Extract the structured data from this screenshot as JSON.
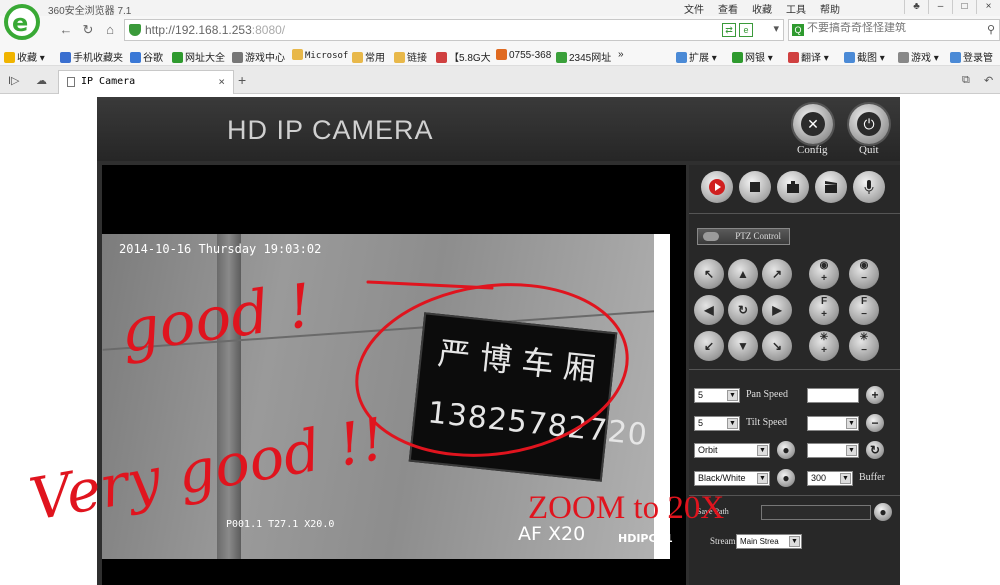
{
  "browser": {
    "app_name": "360安全浏览器 7.1",
    "menu": [
      "文件",
      "查看",
      "收藏",
      "工具",
      "帮助"
    ],
    "url_host": "http://192.168.1.253",
    "url_port": ":8080/",
    "search_placeholder": "不要搞奇奇怪怪建筑",
    "tab_title": "IP Camera",
    "new_tab": "+",
    "bookmarks": [
      {
        "label": "收藏",
        "color": "#f0b400"
      },
      {
        "label": "手机收藏夹",
        "color": "#3a6fd0"
      },
      {
        "label": "谷歌",
        "color": "#3a78d6"
      },
      {
        "label": "网址大全",
        "color": "#2e9a2e"
      },
      {
        "label": "游戏中心",
        "color": "#777777"
      },
      {
        "label": "Microsof",
        "color": "#e8b84a"
      },
      {
        "label": "常用",
        "color": "#e8b84a"
      },
      {
        "label": "链接",
        "color": "#e8b84a"
      },
      {
        "label": "【5.8G大",
        "color": "#d04040"
      },
      {
        "label": "0755-368",
        "color": "#e06a20"
      },
      {
        "label": "2345网址",
        "color": "#3aa03a"
      },
      {
        "label": "»",
        "color": ""
      }
    ],
    "bookmarks_right": [
      {
        "label": "扩展",
        "color": "#4b8ad6"
      },
      {
        "label": "网银",
        "color": "#2e9a2e"
      },
      {
        "label": "翻译",
        "color": "#d04040"
      },
      {
        "label": "截图",
        "color": "#4b8ad6"
      },
      {
        "label": "游戏",
        "color": "#888888"
      },
      {
        "label": "登录管",
        "color": "#4b8ad6"
      }
    ]
  },
  "camera": {
    "title": "HD IP CAMERA",
    "config_label": "Config",
    "quit_label": "Quit",
    "ptz_label": "PTZ Control",
    "osd_datetime": "2014-10-16 Thursday 19:03:02",
    "osd_position": "P001.1 T27.1 X20.0",
    "osd_focus": "AF  X20",
    "osd_channel": "HDIPCA1",
    "sign_text": "严博车厢",
    "sign_number": "13825782720",
    "pan_speed_value": "5",
    "pan_speed_label": "Pan Speed",
    "tilt_speed_value": "5",
    "tilt_speed_label": "Tilt Speed",
    "cruise_value": "Orbit",
    "color_mode_value": "Black/White",
    "buffer_value": "300",
    "buffer_label": "Buffer",
    "save_label": "Save Path",
    "stream_label": "Stream",
    "stream_value": "Main Strea",
    "annotations": {
      "text1": "good !",
      "text2": "Very good !!",
      "text3": "ZOOM to 20X"
    }
  }
}
